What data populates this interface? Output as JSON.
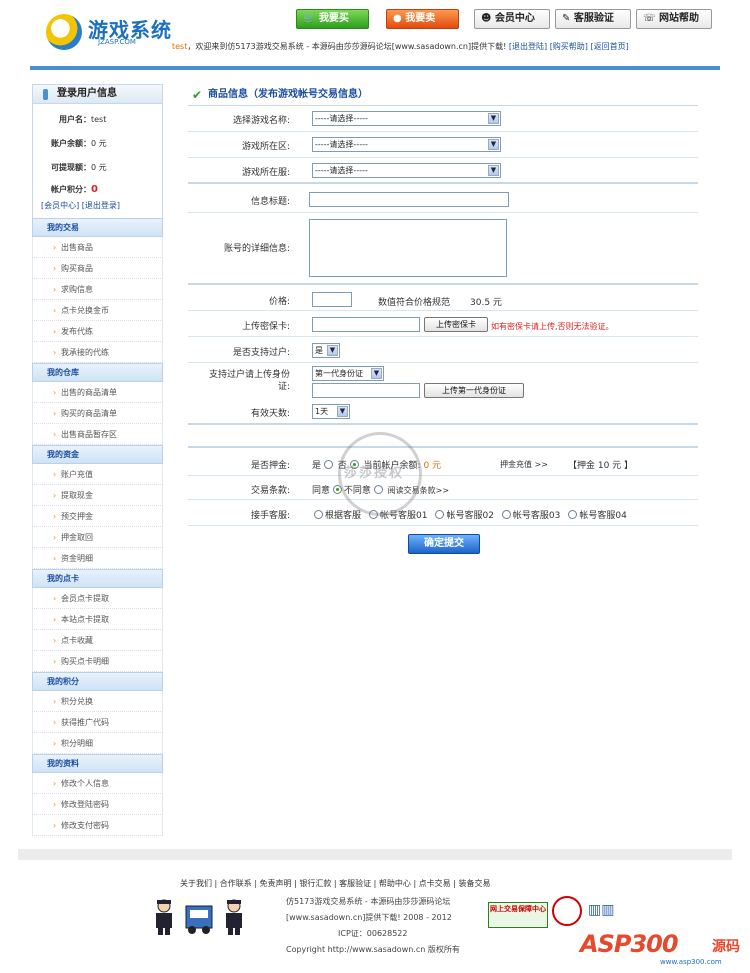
{
  "header": {
    "logo_title": "游戏系统",
    "logo_sub": "JZASP.COM",
    "buttons": [
      "我要买",
      "我要卖",
      "会员中心",
      "客服验证",
      "网站帮助"
    ],
    "welcome_user": "test",
    "welcome_text": "，欢迎来到仿5173游戏交易系统 - 本源码由莎莎源码论坛[www.sasadown.cn]提供下载!",
    "logout": "[退出登陆]",
    "buy_help": "[购买帮助]",
    "home": "[返回首页]"
  },
  "sidebar": {
    "title": "登录用户信息",
    "username_label": "用户名：",
    "username": "test",
    "balance_label": "账户余额：",
    "balance": "0 元",
    "withdraw_label": "可提现额：",
    "withdraw": "0 元",
    "points_label": "帐户积分：",
    "points": "0",
    "member_link": "[会员中心]",
    "logout_link": "[退出登录]",
    "groups": [
      {
        "title": "我的交易",
        "items": [
          "出售商品",
          "购买商品",
          "求购信息",
          "点卡兑换金币",
          "发布代练",
          "我承接的代练"
        ]
      },
      {
        "title": "我的仓库",
        "items": [
          "出售的商品清单",
          "购买的商品清单",
          "出售商品暂存区"
        ]
      },
      {
        "title": "我的资金",
        "items": [
          "账户充值",
          "提取现金",
          "预交押金",
          "押金取回",
          "资金明细"
        ]
      },
      {
        "title": "我的点卡",
        "items": [
          "会员点卡提取",
          "本站点卡提取",
          "点卡收藏",
          "购买点卡明细"
        ]
      },
      {
        "title": "我的积分",
        "items": [
          "积分兑换",
          "获得推广代码",
          "积分明细"
        ]
      },
      {
        "title": "我的资料",
        "items": [
          "修改个人信息",
          "修改登陆密码",
          "修改支付密码"
        ]
      }
    ]
  },
  "form": {
    "title": "商品信息（发布游戏帐号交易信息）",
    "game_label": "选择游戏名称:",
    "game_value": "-----请选择-----",
    "area_label": "游戏所在区:",
    "area_value": "-----请选择-----",
    "server_label": "游戏所在服:",
    "server_value": "-----请选择-----",
    "info_title_label": "信息标题:",
    "detail_label": "账号的详细信息:",
    "price_label": "价格:",
    "price_note": "数值符合价格规范",
    "price_value": "30.5 元",
    "upload_label": "上传密保卡:",
    "upload_button": "上传密保卡",
    "upload_note": "如有密保卡请上传,否则无法验证。",
    "transfer_label": "是否支持过户:",
    "transfer_value": "是",
    "id_label_1": "支持过户请上传身份",
    "id_label_2": "证:",
    "id_type_value": "第一代身份证",
    "id_upload_button": "上传第一代身份证",
    "days_label": "有效天数:",
    "days_value": "1天",
    "deposit_label": "是否押金:",
    "deposit_yes": "是",
    "deposit_no": "否",
    "deposit_balance_label": "当前帐户余额:",
    "deposit_balance": "0 元",
    "deposit_recharge": "押金充值 >>",
    "deposit_amount": "【押金  10 元 】",
    "terms_label": "交易条款:",
    "terms_agree": "同意",
    "terms_disagree": "不同意",
    "terms_read": "阅读交易条款>>",
    "service_label": "接手客服:",
    "services": [
      "根据客服",
      "帐号客服01",
      "帐号客服02",
      "帐号客服03",
      "帐号客服04"
    ],
    "submit": "确定提交"
  },
  "watermark": {
    "text": "莎莎授权"
  },
  "footer": {
    "links": "关于我们  |  合作联系  |  免责声明  |  银行汇款  |  客服验证  |  帮助中心  |  点卡交易  |  装备交易",
    "line1": "仿5173游戏交易系统 - 本源码由莎莎源码论坛",
    "line2": "[www.sasadown.cn]提供下载!    2008 - 2012",
    "line3": "ICP证：00628522",
    "line4": "Copyright http://www.sasadown.cn 版权所有",
    "badge1": "网上交易保障中心",
    "asp_logo": "ASP300",
    "asp_code": "源码",
    "asp_url": "www.asp300.com"
  }
}
